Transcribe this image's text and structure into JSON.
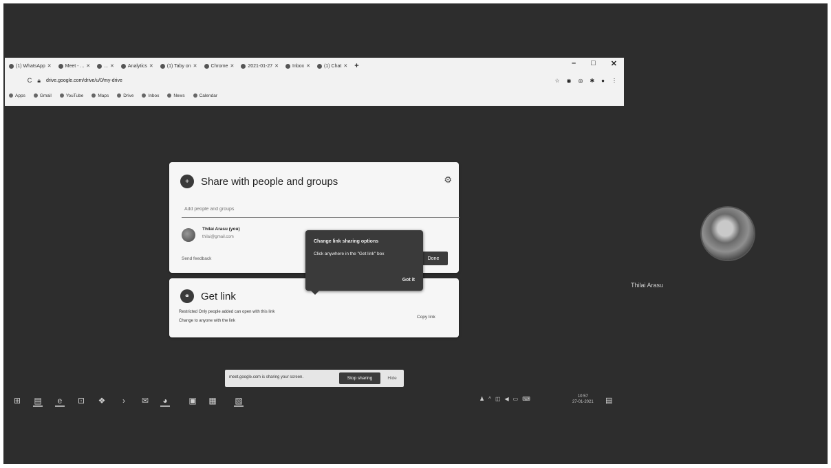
{
  "browser": {
    "tabs": [
      {
        "label": "(1) WhatsApp",
        "icon": "whatsapp-icon"
      },
      {
        "label": "Meet - ...",
        "icon": "meet-icon"
      },
      {
        "label": "...",
        "icon": "tab-icon"
      },
      {
        "label": "Analytics",
        "icon": "analytics-icon"
      },
      {
        "label": "(1) Taby on",
        "icon": "teams-icon"
      },
      {
        "label": "Chrome",
        "icon": "chrome-icon"
      },
      {
        "label": "2021-01-27",
        "icon": "doc-icon"
      },
      {
        "label": "Inbox",
        "icon": "gmail-icon"
      },
      {
        "label": "(1) Chat",
        "icon": "chat-icon"
      }
    ],
    "new_tab": "+",
    "window_controls": [
      "–",
      "□",
      "✕"
    ],
    "url": "drive.google.com/drive/u/0/my-drive",
    "bookmarks": [
      "Apps",
      "Gmail",
      "YouTube",
      "Maps",
      "Drive",
      "Inbox",
      "News",
      "Calendar"
    ]
  },
  "share_dialog": {
    "title": "Share with people and groups",
    "input_placeholder": "Add people and groups",
    "owner_name": "Thilai Arasu (you)",
    "owner_email": "thilai@gmail.com",
    "feedback": "Send feedback",
    "done": "Done"
  },
  "get_link": {
    "title": "Get link",
    "restricted": "Restricted Only people added can open with this link",
    "change": "Change to anyone with the link",
    "copy": "Copy link"
  },
  "tooltip": {
    "title": "Change link sharing options",
    "body": "Click anywhere in the \"Get link\" box",
    "action": "Got it"
  },
  "participant": {
    "name": "Thilai Arasu"
  },
  "sharing_bar": {
    "message": "meet.google.com is sharing your screen.",
    "stop": "Stop sharing",
    "hide": "Hide"
  },
  "taskbar": {
    "clock_time": "10:57",
    "clock_date": "27-01-2021"
  },
  "colors": {
    "background": "#2d2d2d",
    "card": "#f6f6f6",
    "tooltip": "#3a3a3a"
  }
}
